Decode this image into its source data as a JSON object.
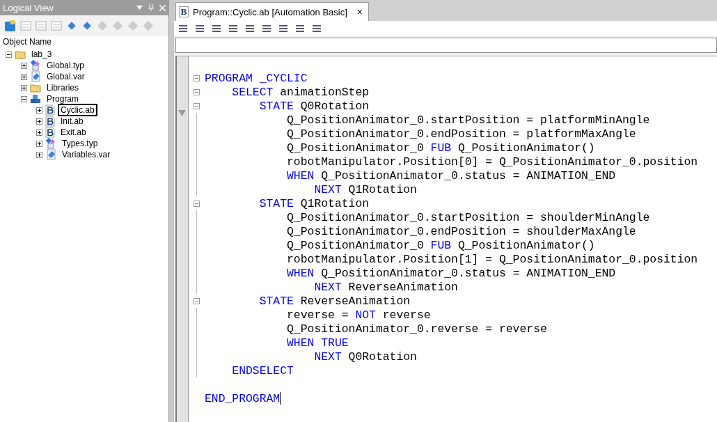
{
  "left_panel": {
    "title": "Logical View",
    "column_header": "Object Name",
    "tree": [
      {
        "label": "lab_3",
        "kind": "folder",
        "expanded": true,
        "selected": false,
        "children": [
          {
            "label": "Global.typ",
            "kind": "types",
            "expanded": false,
            "selected": false
          },
          {
            "label": "Global.var",
            "kind": "variables",
            "expanded": false,
            "selected": false
          },
          {
            "label": "Libraries",
            "kind": "folder",
            "expanded": false,
            "selected": false
          },
          {
            "label": "Program",
            "kind": "program",
            "expanded": true,
            "selected": false,
            "children": [
              {
                "label": "Cyclic.ab",
                "kind": "basic",
                "expanded": false,
                "selected": true
              },
              {
                "label": "Init.ab",
                "kind": "basic",
                "expanded": false,
                "selected": false
              },
              {
                "label": "Exit.ab",
                "kind": "basic",
                "expanded": false,
                "selected": false
              },
              {
                "label": "Types.typ",
                "kind": "types",
                "expanded": false,
                "selected": false
              },
              {
                "label": "Variables.var",
                "kind": "variables",
                "expanded": false,
                "selected": false
              }
            ]
          }
        ]
      }
    ]
  },
  "editor": {
    "tab": {
      "title": "Program::Cyclic.ab [Automation Basic]",
      "icon": "B",
      "close": "×"
    },
    "lines": [
      {
        "fold": true,
        "tokens": [
          {
            "kind": "keyword",
            "text": "PROGRAM _CYCLIC"
          }
        ]
      },
      {
        "fold": true,
        "tokens": [
          {
            "kind": "keyword",
            "text": "    SELECT"
          },
          {
            "kind": "plain",
            "text": " animationStep"
          }
        ]
      },
      {
        "fold": true,
        "tokens": [
          {
            "kind": "keyword",
            "text": "        STATE"
          },
          {
            "kind": "plain",
            "text": " Q0Rotation"
          }
        ]
      },
      {
        "fold": false,
        "tokens": [
          {
            "kind": "plain",
            "text": "            Q_PositionAnimator_0.startPosition = platformMinAngle"
          }
        ]
      },
      {
        "fold": false,
        "tokens": [
          {
            "kind": "plain",
            "text": "            Q_PositionAnimator_0.endPosition = platformMaxAngle"
          }
        ]
      },
      {
        "fold": false,
        "tokens": [
          {
            "kind": "plain",
            "text": "            Q_PositionAnimator_0 "
          },
          {
            "kind": "keyword",
            "text": "FUB"
          },
          {
            "kind": "plain",
            "text": " Q_PositionAnimator()"
          }
        ]
      },
      {
        "fold": false,
        "tokens": [
          {
            "kind": "plain",
            "text": "            robotManipulator.Position[0] = Q_PositionAnimator_0.position"
          }
        ]
      },
      {
        "fold": false,
        "tokens": [
          {
            "kind": "keyword",
            "text": "            WHEN"
          },
          {
            "kind": "plain",
            "text": " Q_PositionAnimator_0.status = ANIMATION_END"
          }
        ]
      },
      {
        "fold": false,
        "tokens": [
          {
            "kind": "keyword",
            "text": "                NEXT"
          },
          {
            "kind": "plain",
            "text": " Q1Rotation"
          }
        ]
      },
      {
        "fold": true,
        "tokens": [
          {
            "kind": "keyword",
            "text": "        STATE"
          },
          {
            "kind": "plain",
            "text": " Q1Rotation"
          }
        ]
      },
      {
        "fold": false,
        "tokens": [
          {
            "kind": "plain",
            "text": "            Q_PositionAnimator_0.startPosition = shoulderMinAngle"
          }
        ]
      },
      {
        "fold": false,
        "tokens": [
          {
            "kind": "plain",
            "text": "            Q_PositionAnimator_0.endPosition = shoulderMaxAngle"
          }
        ]
      },
      {
        "fold": false,
        "tokens": [
          {
            "kind": "plain",
            "text": "            Q_PositionAnimator_0 "
          },
          {
            "kind": "keyword",
            "text": "FUB"
          },
          {
            "kind": "plain",
            "text": " Q_PositionAnimator()"
          }
        ]
      },
      {
        "fold": false,
        "tokens": [
          {
            "kind": "plain",
            "text": "            robotManipulator.Position[1] = Q_PositionAnimator_0.position"
          }
        ]
      },
      {
        "fold": false,
        "tokens": [
          {
            "kind": "keyword",
            "text": "            WHEN"
          },
          {
            "kind": "plain",
            "text": " Q_PositionAnimator_0.status = ANIMATION_END"
          }
        ]
      },
      {
        "fold": false,
        "tokens": [
          {
            "kind": "keyword",
            "text": "                NEXT"
          },
          {
            "kind": "plain",
            "text": " ReverseAnimation"
          }
        ]
      },
      {
        "fold": true,
        "tokens": [
          {
            "kind": "keyword",
            "text": "        STATE"
          },
          {
            "kind": "plain",
            "text": " ReverseAnimation"
          }
        ]
      },
      {
        "fold": false,
        "tokens": [
          {
            "kind": "plain",
            "text": "            reverse = "
          },
          {
            "kind": "keyword",
            "text": "NOT"
          },
          {
            "kind": "plain",
            "text": " reverse"
          }
        ]
      },
      {
        "fold": false,
        "tokens": [
          {
            "kind": "plain",
            "text": "            Q_PositionAnimator_0.reverse = reverse"
          }
        ]
      },
      {
        "fold": false,
        "tokens": [
          {
            "kind": "keyword",
            "text": "            WHEN TRUE"
          }
        ]
      },
      {
        "fold": false,
        "tokens": [
          {
            "kind": "keyword",
            "text": "                NEXT"
          },
          {
            "kind": "plain",
            "text": " Q0Rotation"
          }
        ]
      },
      {
        "fold": false,
        "tokens": [
          {
            "kind": "keyword",
            "text": "    ENDSELECT"
          }
        ]
      },
      {
        "fold": false
      },
      {
        "fold": false,
        "tokens": [
          {
            "kind": "keyword",
            "text": "END_PROGRAM"
          }
        ]
      }
    ]
  }
}
